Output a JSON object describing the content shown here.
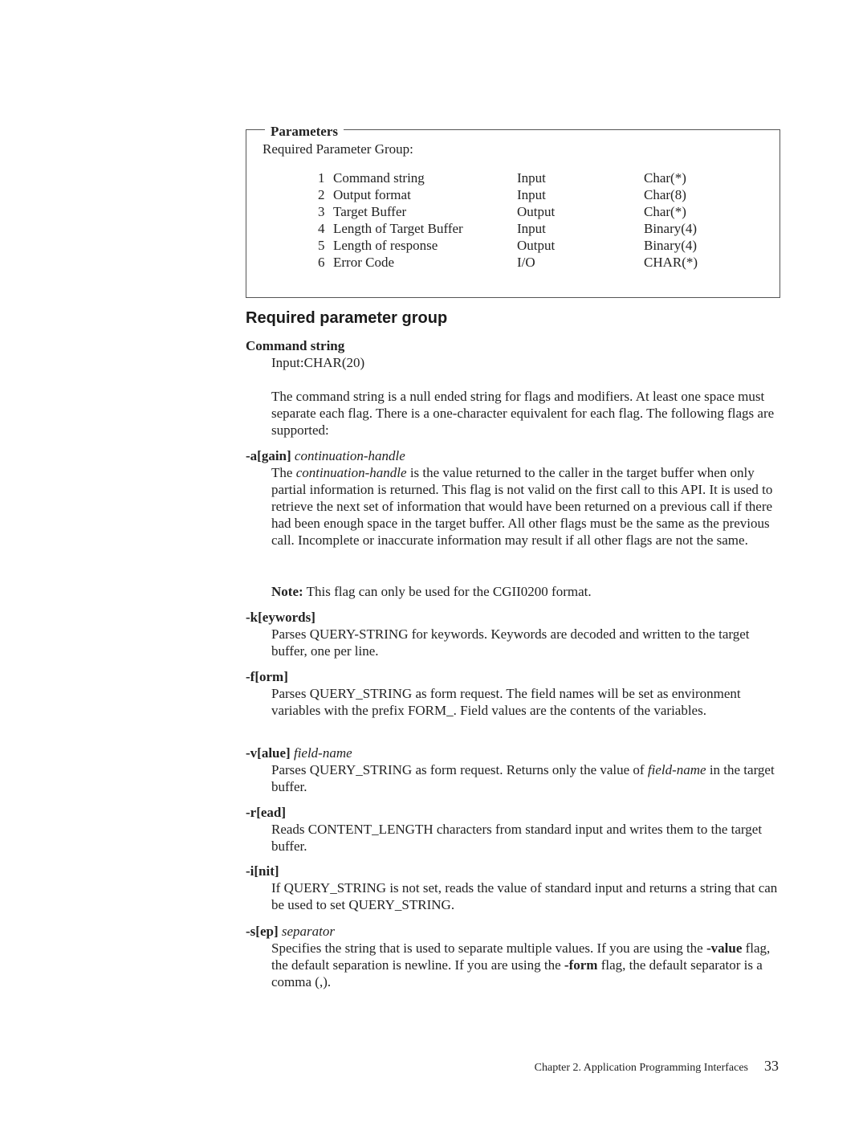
{
  "params_box": {
    "title": "Parameters",
    "subtitle": "Required Parameter Group:",
    "rows": [
      {
        "num": "1",
        "name": "Command string",
        "usage": "Input",
        "type": "Char(*)"
      },
      {
        "num": "2",
        "name": "Output format",
        "usage": "Input",
        "type": "Char(8)"
      },
      {
        "num": "3",
        "name": "Target Buffer",
        "usage": "Output",
        "type": "Char(*)"
      },
      {
        "num": "4",
        "name": "Length of Target Buffer",
        "usage": "Input",
        "type": "Binary(4)"
      },
      {
        "num": "5",
        "name": "Length of response",
        "usage": "Output",
        "type": "Binary(4)"
      },
      {
        "num": "6",
        "name": "Error Code",
        "usage": "I/O",
        "type": "CHAR(*)"
      }
    ]
  },
  "section_heading": "Required parameter group",
  "command_string": {
    "term": "Command string",
    "type": "Input:CHAR(20)",
    "desc": "The command string is a null ended string for flags and modifiers. At least one space must separate each flag. There is a one-character equivalent for each flag. The following flags are supported:"
  },
  "flags": {
    "again": {
      "term": "-a[gain]",
      "arg": "continuation-handle",
      "desc_1": "The ",
      "desc_2": "continuation-handle",
      "desc_3": " is the value returned to the caller in the target buffer when only partial information is returned. This flag is not valid on the first call to this API. It is used to retrieve the next set of information that would have been returned on a previous call if there had been enough space in the target buffer. All other flags must be the same as the previous call. Incomplete or inaccurate information may result if all other flags are not the same.",
      "note_label": "Note:",
      "note": " This flag can only be used for the CGII0200 format."
    },
    "keywords": {
      "term": "-k[eywords]",
      "desc": "Parses QUERY-STRING for keywords. Keywords are decoded and written to the target buffer, one per line."
    },
    "form": {
      "term": "-f[orm]",
      "desc": "Parses QUERY_STRING as form request. The field names will be set as environment variables with the prefix FORM_. Field values are the contents of the variables."
    },
    "value": {
      "term": "-v[alue]",
      "arg": "field-name",
      "desc_1": "Parses QUERY_STRING as form request. Returns only the value of ",
      "desc_2": "field-name",
      "desc_3": " in the target buffer."
    },
    "read": {
      "term": "-r[ead]",
      "desc": "Reads CONTENT_LENGTH characters from standard input and writes them to the target buffer."
    },
    "init": {
      "term": "-i[nit]",
      "desc": "If QUERY_STRING is not set, reads the value of standard input and returns a string that can be used to set QUERY_STRING."
    },
    "sep": {
      "term": "-s[ep]",
      "arg": "separator",
      "desc_1": "Specifies the string that is used to separate multiple values. If you are using the ",
      "desc_2": "-value",
      "desc_3": " flag, the default separation is newline. If you are using the ",
      "desc_4": "-form",
      "desc_5": " flag, the default separator is a comma (,)."
    }
  },
  "footer": {
    "chapter": "Chapter 2. Application Programming Interfaces",
    "page": "33"
  }
}
